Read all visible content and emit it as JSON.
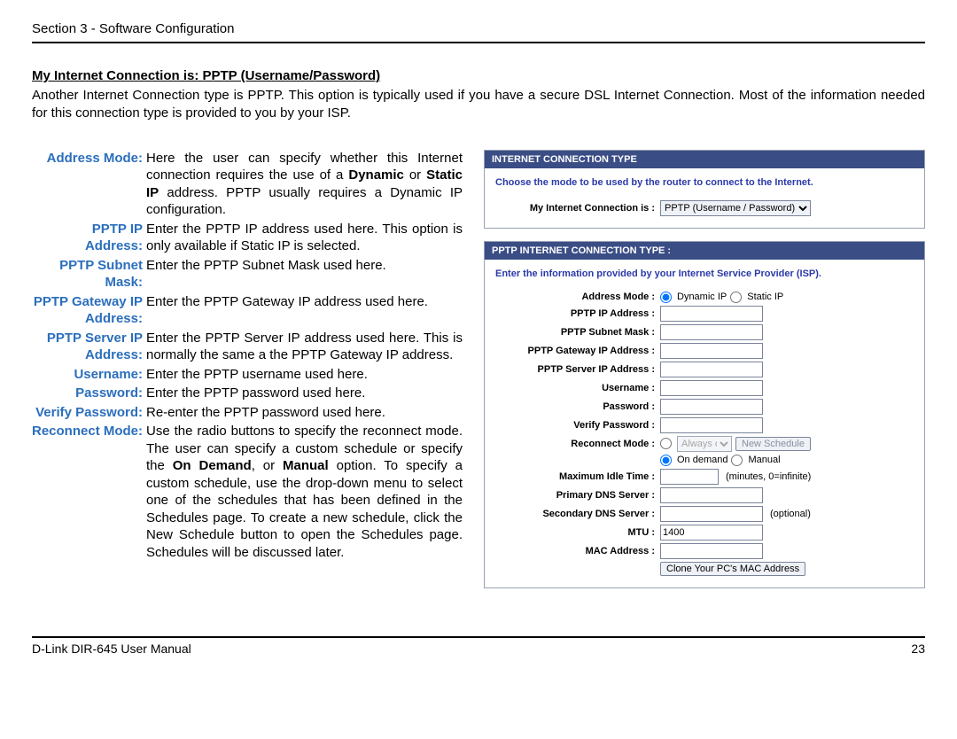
{
  "header": {
    "section_label": "Section 3 - Software Configuration"
  },
  "title": {
    "heading": "My Internet Connection is: PPTP (Username/Password)",
    "intro": "Another Internet Connection type is PPTP. This option is typically used if you have a secure DSL Internet Connection. Most of the information needed for this connection type is provided to you by your ISP."
  },
  "definitions": [
    {
      "label": "Address Mode:",
      "desc_pre": "Here the user can specify whether this Internet connection requires the use of a ",
      "b1": "Dynamic",
      "mid1": " or ",
      "b2": "Static IP",
      "desc_post": " address. PPTP usually requires a Dynamic IP configuration."
    },
    {
      "label": "PPTP IP Address:",
      "desc": "Enter the PPTP IP address used here. This option is only available if Static IP is selected."
    },
    {
      "label": "PPTP Subnet Mask:",
      "desc": "Enter the PPTP Subnet Mask used here."
    },
    {
      "label": "PPTP Gateway IP Address:",
      "desc": "Enter the PPTP Gateway IP address used here."
    },
    {
      "label": "PPTP Server IP Address:",
      "desc": "Enter the PPTP Server IP address used here. This is normally the same a the PPTP Gateway IP address."
    },
    {
      "label": "Username:",
      "desc": "Enter the PPTP username used here."
    },
    {
      "label": "Password:",
      "desc": "Enter the PPTP password used here."
    },
    {
      "label": "Verify Password:",
      "desc": "Re-enter the PPTP password used here."
    },
    {
      "label": "Reconnect Mode:",
      "desc_pre": "Use the radio buttons to specify the reconnect mode. The user can specify a custom schedule or specify the ",
      "b1": "On Demand",
      "mid1": ", or ",
      "b2": "Manual",
      "desc_post": " option. To specify a custom schedule, use the drop-down menu to select one of the schedules that has been defined in the Schedules page. To create a new schedule, click the New Schedule button to open the Schedules page. Schedules will be discussed later."
    }
  ],
  "panel1": {
    "header": "INTERNET CONNECTION TYPE",
    "instruction": "Choose the mode to be used by the router to connect to the Internet.",
    "field_label": "My Internet Connection is :",
    "select_value": "PPTP (Username / Password)"
  },
  "panel2": {
    "header": "PPTP INTERNET CONNECTION TYPE :",
    "instruction": "Enter the information provided by your Internet Service Provider (ISP).",
    "rows": {
      "address_mode": "Address Mode :",
      "address_mode_opt1": "Dynamic IP",
      "address_mode_opt2": "Static IP",
      "pptp_ip": "PPTP IP Address :",
      "pptp_subnet": "PPTP Subnet Mask :",
      "pptp_gateway": "PPTP Gateway IP Address :",
      "pptp_server": "PPTP Server IP Address :",
      "username": "Username :",
      "password": "Password :",
      "verify_password": "Verify Password :",
      "reconnect_mode": "Reconnect Mode :",
      "reconnect_sel": "Always o",
      "reconnect_btn": "New Schedule",
      "reconnect_opt1": "On demand",
      "reconnect_opt2": "Manual",
      "max_idle": "Maximum Idle Time :",
      "max_idle_hint": "(minutes, 0=infinite)",
      "primary_dns": "Primary DNS Server :",
      "secondary_dns": "Secondary DNS Server :",
      "secondary_hint": "(optional)",
      "mtu": "MTU :",
      "mtu_value": "1400",
      "mac": "MAC Address :",
      "clone_btn": "Clone Your PC's MAC Address"
    }
  },
  "footer": {
    "left": "D-Link DIR-645 User Manual",
    "right": "23"
  }
}
